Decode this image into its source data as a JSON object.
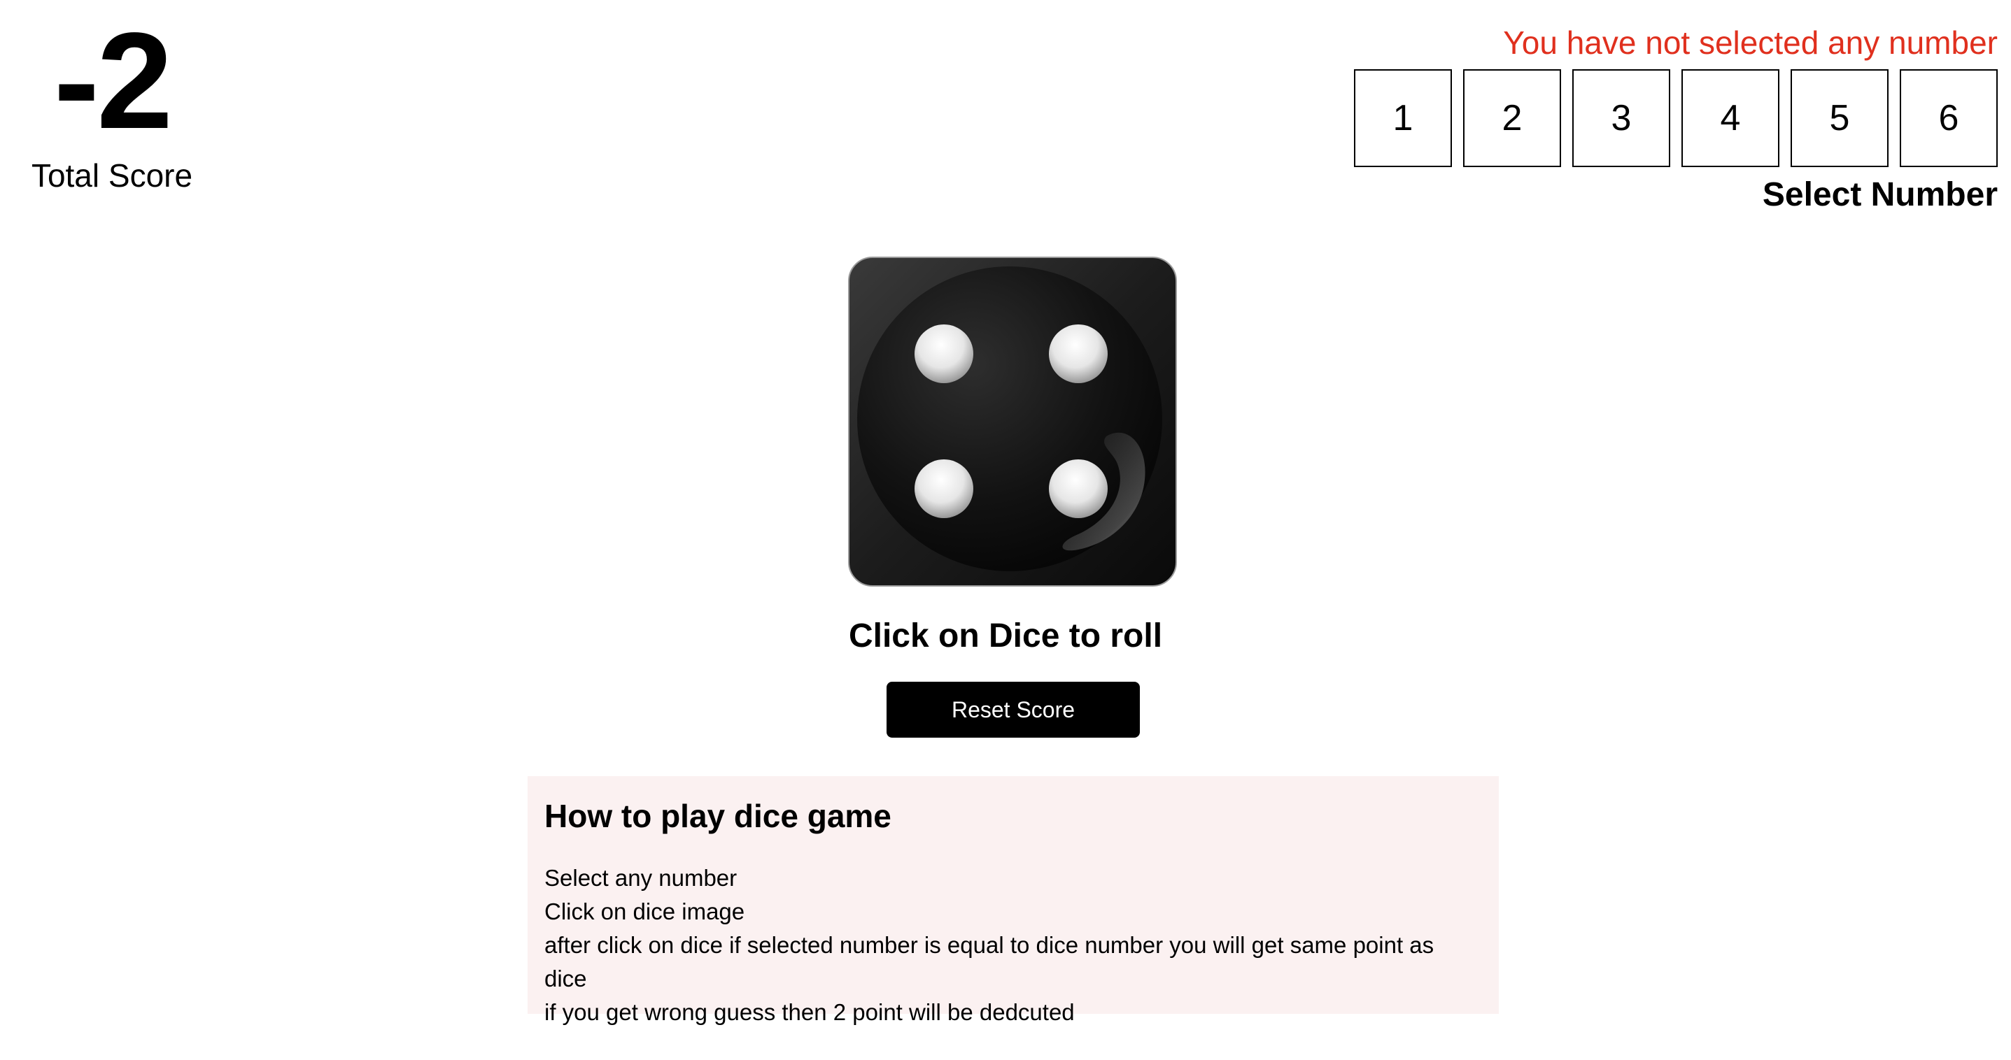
{
  "score": {
    "value": "-2",
    "label": "Total Score"
  },
  "selector": {
    "error_message": "You have not selected any number",
    "numbers": [
      "1",
      "2",
      "3",
      "4",
      "5",
      "6"
    ],
    "title": "Select Number"
  },
  "dice": {
    "face_value": 4,
    "image": "dice-four-icon"
  },
  "roll_hint": "Click on Dice to roll",
  "reset_button": "Reset Score",
  "rules": {
    "title": "How to play dice game",
    "lines": [
      "Select any number",
      "Click on dice image",
      "after click on dice if selected number is equal to dice number you will get same point as dice",
      "if you get wrong guess then 2 point will be dedcuted"
    ]
  },
  "colors": {
    "error": "#e0301e",
    "button_bg": "#000000",
    "rules_bg": "#fbf1f1"
  }
}
